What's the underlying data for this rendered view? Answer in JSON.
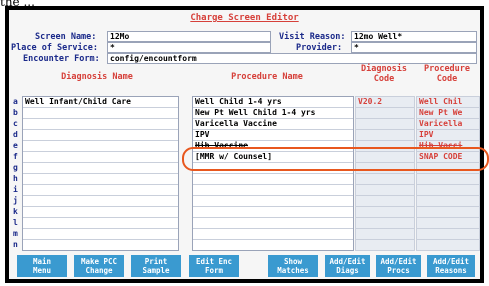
{
  "cutoff_text": "the ...",
  "title": "Charge Screen Editor",
  "form": {
    "screen_name_label": "Screen Name:",
    "screen_name_value": "12Mo",
    "visit_reason_label": "Visit Reason:",
    "visit_reason_value": "12mo Well*",
    "place_label": "Place of Service:",
    "place_value": "*",
    "provider_label": "Provider:",
    "provider_value": "*",
    "encounter_label": "Encounter Form:",
    "encounter_value": "config/encountform"
  },
  "columns": {
    "diagnosis_name": "Diagnosis Name",
    "procedure_name": "Procedure Name",
    "diagnosis_code_1": "Diagnosis",
    "diagnosis_code_2": "Code",
    "procedure_code_1": "Procedure",
    "procedure_code_2": "Code"
  },
  "row_letters": [
    "a",
    "b",
    "c",
    "d",
    "e",
    "f",
    "g",
    "h",
    "i",
    "j",
    "k",
    "l",
    "m",
    "n"
  ],
  "diagnosis_names": [
    "Well Infant/Child Care",
    "",
    "",
    "",
    "",
    "",
    "",
    "",
    "",
    "",
    "",
    "",
    "",
    ""
  ],
  "procedure_names": [
    "Well Child 1-4 yrs",
    "New Pt Well Child 1-4 yrs",
    "Varicella Vaccine",
    "IPV",
    "Hib Vaccine",
    "[MMR w/ Counsel]",
    "",
    "",
    "",
    "",
    "",
    "",
    "",
    ""
  ],
  "diagnosis_codes": [
    "V20.2",
    "",
    "",
    "",
    "",
    "",
    "",
    "",
    "",
    "",
    "",
    "",
    "",
    ""
  ],
  "procedure_codes": [
    "Well Chil",
    "New Pt We",
    "Varicella",
    "IPV",
    "Hib Vacci",
    "SNAP CODE",
    "",
    "",
    "",
    "",
    "",
    "",
    "",
    ""
  ],
  "buttons": [
    {
      "line1": "Main",
      "line2": "Menu"
    },
    {
      "line1": "Make PCC",
      "line2": "Change"
    },
    {
      "line1": "Print",
      "line2": "Sample"
    },
    {
      "line1": "Edit Enc",
      "line2": "Form"
    },
    {
      "line1": "Show",
      "line2": "Matches"
    },
    {
      "line1": "Add/Edit",
      "line2": "Diags"
    },
    {
      "line1": "Add/Edit",
      "line2": "Procs"
    },
    {
      "line1": "Add/Edit",
      "line2": "Reasons"
    }
  ]
}
